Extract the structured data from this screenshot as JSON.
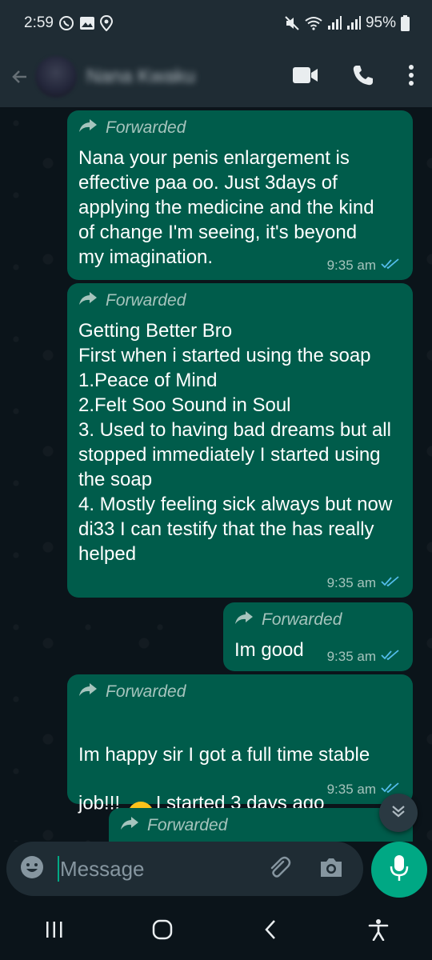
{
  "status_bar": {
    "time": "2:59",
    "battery": "95%",
    "icons": [
      "whatsapp-icon",
      "gallery-icon",
      "location-icon",
      "mute-icon",
      "wifi-icon",
      "signal-icon",
      "signal-icon",
      "battery-icon"
    ]
  },
  "header": {
    "contact_name": "Nana Kwaku",
    "actions": [
      "video-call-icon",
      "voice-call-icon",
      "more-options-icon"
    ]
  },
  "messages": [
    {
      "forwarded_label": "Forwarded",
      "text": "Nana your penis enlargement is effective paa oo. Just 3days of applying the medicine and the kind of change I'm seeing, it's beyond my imagination.",
      "time": "9:35 am",
      "status": "read"
    },
    {
      "forwarded_label": "Forwarded",
      "text": "Getting Better Bro\nFirst when i started using the soap\n1.Peace of Mind\n2.Felt Soo Sound in Soul\n3. Used to having bad dreams but all stopped immediately I started using the soap\n4. Mostly feeling sick always but now di33 I can testify that the has really helped",
      "time": "9:35 am",
      "status": "read"
    },
    {
      "forwarded_label": "Forwarded",
      "text": "Im good",
      "time": "9:35 am",
      "status": "read"
    },
    {
      "forwarded_label": "Forwarded",
      "text_before_emoji": "Im happy sir I got a full time stable job!!! ",
      "emoji": "grinning-face",
      "text_after_emoji": "I started 3 days ago",
      "time": "9:35 am",
      "status": "read"
    },
    {
      "forwarded_label": "Forwarded"
    }
  ],
  "composer": {
    "placeholder": "Message"
  },
  "colors": {
    "background": "#0b141a",
    "bar": "#1f2c34",
    "outgoing_bubble": "#005c4b",
    "accent": "#00a884",
    "read_tick": "#53bdeb"
  }
}
